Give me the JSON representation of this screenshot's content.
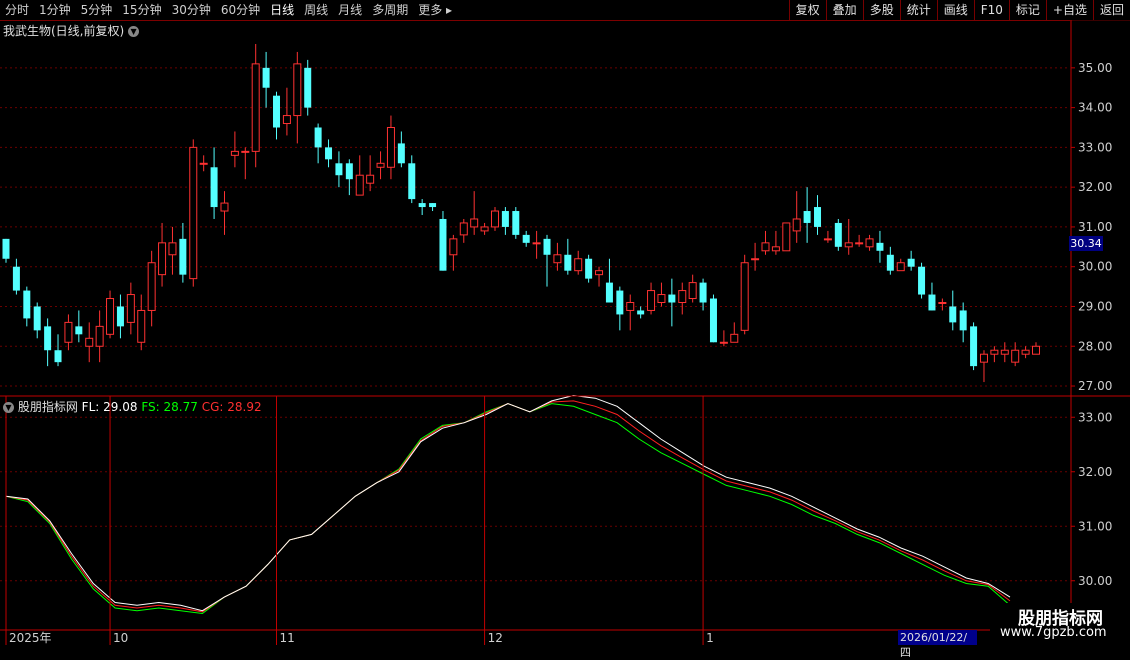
{
  "toolbar": {
    "periods": [
      "分时",
      "1分钟",
      "5分钟",
      "15分钟",
      "30分钟",
      "60分钟",
      "日线",
      "周线",
      "月线",
      "多周期"
    ],
    "active_period": "日线",
    "more_label": "更多",
    "actions": [
      "复权",
      "叠加",
      "多股",
      "统计",
      "画线",
      "F10",
      "标记",
      "+自选",
      "返回"
    ]
  },
  "main_title": "我武生物(日线,前复权)",
  "indicator": {
    "name": "股朋指标网",
    "fl_label": "FL:",
    "fl_value": "29.08",
    "fs_label": "FS:",
    "fs_value": "28.77",
    "cg_label": "CG:",
    "cg_value": "28.92"
  },
  "price_axis": [
    "35.00",
    "34.00",
    "33.00",
    "32.00",
    "31.00",
    "30.00",
    "29.00",
    "28.00",
    "27.00"
  ],
  "indicator_axis": [
    "33.00",
    "32.00",
    "31.00",
    "30.00"
  ],
  "current_price": "30.34",
  "date_axis": [
    {
      "label": "2025年",
      "idx": 0
    },
    {
      "label": "10",
      "idx": 10
    },
    {
      "label": "11",
      "idx": 26
    },
    {
      "label": "12",
      "idx": 46
    },
    {
      "label": "1",
      "idx": 67
    }
  ],
  "highlight_date": "2026/01/22/四",
  "watermark": {
    "line1": "股朋指标网",
    "line2": "www.7gpzb.com"
  },
  "colors": {
    "up": "#ff3232",
    "down": "#54ffff",
    "fl": "#ffffff",
    "fs": "#00ff00",
    "cg": "#ff2020",
    "grid": "#6b0000",
    "axis": "#c00000"
  },
  "chart_data": {
    "type": "candlestick",
    "candles": [
      [
        30.7,
        30.2,
        30.7,
        30.1
      ],
      [
        30.0,
        29.4,
        30.2,
        29.3
      ],
      [
        29.4,
        28.7,
        29.5,
        28.5
      ],
      [
        29.0,
        28.4,
        29.1,
        28.2
      ],
      [
        28.5,
        27.9,
        28.7,
        27.5
      ],
      [
        27.9,
        27.6,
        28.3,
        27.5
      ],
      [
        28.1,
        28.6,
        28.8,
        27.9
      ],
      [
        28.5,
        28.3,
        28.9,
        28.1
      ],
      [
        28.0,
        28.2,
        28.6,
        27.6
      ],
      [
        28.0,
        28.5,
        28.9,
        27.6
      ],
      [
        28.3,
        29.2,
        29.4,
        28.2
      ],
      [
        29.0,
        28.5,
        29.3,
        28.2
      ],
      [
        28.6,
        29.3,
        29.6,
        28.3
      ],
      [
        28.1,
        28.9,
        29.3,
        27.9
      ],
      [
        28.9,
        30.1,
        30.4,
        28.5
      ],
      [
        29.8,
        30.6,
        31.1,
        29.5
      ],
      [
        30.3,
        30.6,
        31.0,
        29.8
      ],
      [
        30.7,
        29.8,
        31.1,
        29.6
      ],
      [
        29.7,
        33.0,
        33.2,
        29.5
      ],
      [
        32.6,
        32.6,
        32.8,
        32.4
      ],
      [
        32.5,
        31.5,
        33.0,
        31.2
      ],
      [
        31.4,
        31.6,
        31.9,
        30.8
      ],
      [
        32.8,
        32.9,
        33.4,
        32.5
      ],
      [
        32.9,
        32.9,
        33.0,
        32.2
      ],
      [
        32.9,
        35.1,
        35.6,
        32.5
      ],
      [
        35.0,
        34.5,
        35.4,
        34.0
      ],
      [
        34.3,
        33.5,
        34.4,
        33.2
      ],
      [
        33.6,
        33.8,
        34.5,
        33.3
      ],
      [
        33.8,
        35.1,
        35.4,
        33.1
      ],
      [
        35.0,
        34.0,
        35.2,
        33.8
      ],
      [
        33.5,
        33.0,
        33.6,
        32.6
      ],
      [
        33.0,
        32.7,
        33.2,
        32.5
      ],
      [
        32.6,
        32.3,
        32.9,
        32.0
      ],
      [
        32.6,
        32.2,
        32.7,
        31.8
      ],
      [
        31.8,
        32.3,
        32.8,
        31.9
      ],
      [
        32.1,
        32.3,
        32.8,
        31.9
      ],
      [
        32.5,
        32.6,
        32.9,
        32.2
      ],
      [
        32.5,
        33.5,
        33.8,
        32.2
      ],
      [
        33.1,
        32.6,
        33.4,
        32.5
      ],
      [
        32.6,
        31.7,
        32.8,
        31.6
      ],
      [
        31.6,
        31.5,
        31.7,
        31.3
      ],
      [
        31.6,
        31.5,
        31.6,
        31.4
      ],
      [
        31.2,
        29.9,
        31.4,
        29.9
      ],
      [
        30.3,
        30.7,
        30.8,
        29.9
      ],
      [
        30.8,
        31.1,
        31.2,
        30.6
      ],
      [
        31.0,
        31.2,
        31.9,
        30.8
      ],
      [
        30.9,
        31.0,
        31.1,
        30.8
      ],
      [
        31.0,
        31.4,
        31.5,
        30.9
      ],
      [
        31.4,
        31.0,
        31.5,
        30.8
      ],
      [
        31.4,
        30.8,
        31.5,
        30.7
      ],
      [
        30.8,
        30.6,
        30.9,
        30.5
      ],
      [
        30.6,
        30.6,
        30.9,
        30.2
      ],
      [
        30.7,
        30.3,
        30.8,
        29.5
      ],
      [
        30.1,
        30.3,
        30.6,
        29.9
      ],
      [
        30.3,
        29.9,
        30.7,
        29.8
      ],
      [
        29.9,
        30.2,
        30.4,
        29.8
      ],
      [
        30.2,
        29.7,
        30.3,
        29.6
      ],
      [
        29.8,
        29.9,
        30.0,
        29.5
      ],
      [
        29.6,
        29.1,
        30.2,
        29.1
      ],
      [
        29.4,
        28.8,
        29.5,
        28.4
      ],
      [
        28.9,
        29.1,
        29.3,
        28.4
      ],
      [
        28.9,
        28.8,
        29.0,
        28.7
      ],
      [
        28.9,
        29.4,
        29.6,
        28.8
      ],
      [
        29.1,
        29.3,
        29.6,
        29.0
      ],
      [
        29.3,
        29.1,
        29.7,
        28.5
      ],
      [
        29.1,
        29.4,
        29.6,
        28.8
      ],
      [
        29.2,
        29.6,
        29.8,
        29.1
      ],
      [
        29.6,
        29.1,
        29.7,
        28.9
      ],
      [
        29.2,
        28.1,
        29.3,
        28.1
      ],
      [
        28.1,
        28.1,
        28.4,
        28.0
      ],
      [
        28.1,
        28.3,
        28.6,
        28.1
      ],
      [
        28.4,
        30.1,
        30.3,
        28.3
      ],
      [
        30.2,
        30.2,
        30.6,
        29.9
      ],
      [
        30.4,
        30.6,
        30.9,
        30.3
      ],
      [
        30.4,
        30.5,
        30.9,
        30.3
      ],
      [
        30.4,
        31.1,
        31.1,
        30.4
      ],
      [
        30.9,
        31.2,
        31.9,
        30.6
      ],
      [
        31.4,
        31.1,
        32.0,
        30.6
      ],
      [
        31.5,
        31.0,
        31.8,
        30.8
      ],
      [
        30.7,
        30.7,
        30.9,
        30.6
      ],
      [
        31.1,
        30.5,
        31.2,
        30.4
      ],
      [
        30.5,
        30.6,
        31.2,
        30.3
      ],
      [
        30.6,
        30.6,
        30.8,
        30.5
      ],
      [
        30.5,
        30.7,
        30.8,
        30.4
      ],
      [
        30.6,
        30.4,
        30.9,
        30.1
      ],
      [
        30.3,
        29.9,
        30.5,
        29.8
      ],
      [
        29.9,
        30.1,
        30.2,
        29.9
      ],
      [
        30.2,
        30.0,
        30.4,
        29.9
      ],
      [
        30.0,
        29.3,
        30.1,
        29.2
      ],
      [
        29.3,
        28.9,
        29.6,
        28.9
      ],
      [
        29.1,
        29.1,
        29.2,
        28.9
      ],
      [
        29.0,
        28.6,
        29.4,
        28.4
      ],
      [
        28.9,
        28.4,
        29.1,
        28.1
      ],
      [
        28.5,
        27.5,
        28.6,
        27.4
      ],
      [
        27.6,
        27.8,
        27.9,
        27.1
      ],
      [
        27.8,
        27.9,
        28.0,
        27.6
      ],
      [
        27.8,
        27.9,
        28.1,
        27.6
      ],
      [
        27.6,
        27.9,
        28.1,
        27.5
      ],
      [
        27.8,
        27.9,
        28.0,
        27.7
      ],
      [
        27.8,
        28.0,
        28.1,
        27.8
      ]
    ],
    "indicator_y_range": [
      29.5,
      33.5
    ],
    "fl": [
      31.55,
      31.5,
      31.1,
      30.5,
      29.95,
      29.6,
      29.55,
      29.6,
      29.55,
      29.45,
      29.7,
      29.9,
      30.3,
      30.75,
      30.85,
      31.2,
      31.55,
      31.8,
      32.0,
      32.55,
      32.8,
      32.9,
      33.05,
      33.25,
      33.1,
      33.3,
      33.4,
      33.35,
      33.2,
      32.9,
      32.6,
      32.35,
      32.1,
      31.9,
      31.8,
      31.7,
      31.55,
      31.35,
      31.15,
      30.95,
      30.8,
      30.6,
      30.45,
      30.25,
      30.05,
      29.95,
      29.7
    ],
    "fs": [
      31.55,
      31.45,
      31.05,
      30.4,
      29.85,
      29.5,
      29.45,
      29.5,
      29.45,
      29.4,
      29.7,
      29.9,
      30.3,
      30.75,
      30.85,
      31.2,
      31.55,
      31.8,
      32.05,
      32.6,
      32.85,
      32.9,
      33.1,
      33.25,
      33.1,
      33.25,
      33.2,
      33.05,
      32.9,
      32.6,
      32.35,
      32.15,
      31.95,
      31.75,
      31.65,
      31.55,
      31.4,
      31.2,
      31.05,
      30.85,
      30.7,
      30.5,
      30.3,
      30.1,
      29.95,
      29.9,
      29.55
    ],
    "cg": [
      31.55,
      31.48,
      31.08,
      30.45,
      29.9,
      29.55,
      29.5,
      29.55,
      29.5,
      29.43,
      29.7,
      29.9,
      30.3,
      30.75,
      30.85,
      31.2,
      31.55,
      31.8,
      32.03,
      32.57,
      32.83,
      32.9,
      33.08,
      33.25,
      33.1,
      33.28,
      33.3,
      33.2,
      33.05,
      32.75,
      32.48,
      32.25,
      32.03,
      31.83,
      31.73,
      31.63,
      31.48,
      31.28,
      31.1,
      30.9,
      30.75,
      30.55,
      30.38,
      30.18,
      30.0,
      29.93,
      29.63
    ]
  }
}
